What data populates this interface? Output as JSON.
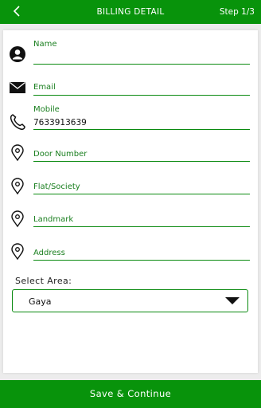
{
  "header": {
    "title": "BILLING DETAIL",
    "step": "Step 1/3"
  },
  "fields": {
    "name": {
      "label": "Name",
      "value": ""
    },
    "email": {
      "label": "Email",
      "value": ""
    },
    "mobile": {
      "label": "Mobile",
      "value": "7633913639"
    },
    "door": {
      "label": "Door Number",
      "value": ""
    },
    "flat": {
      "label": "Flat/Society",
      "value": ""
    },
    "landmark": {
      "label": "Landmark",
      "value": ""
    },
    "address": {
      "label": "Address",
      "value": ""
    }
  },
  "area": {
    "label": "Select Area:",
    "selected": "Gaya"
  },
  "footer": {
    "button": "Save & Continue"
  },
  "colors": {
    "brand": "#08930b",
    "label": "#1a7f1f"
  }
}
